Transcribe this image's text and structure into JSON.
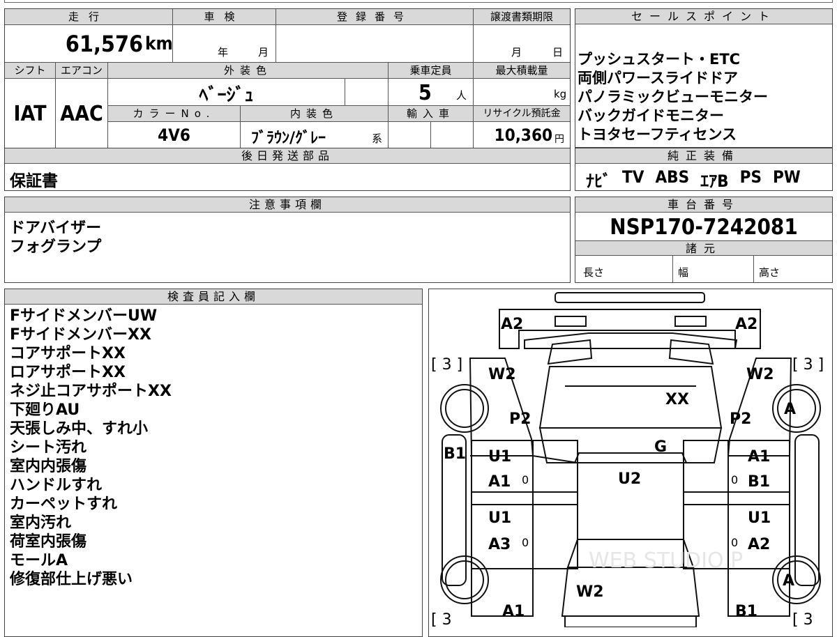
{
  "vehicle": {
    "mileage_label": "走行",
    "mileage": "61,576",
    "mileage_unit": "km",
    "inspection_label": "車検",
    "inspection_year": "年",
    "inspection_month": "月",
    "registration_label": "登録番号",
    "registration_value": "",
    "transfer_label": "譲渡書類期限",
    "transfer_month": "月",
    "transfer_day": "日",
    "shift_label": "シフト",
    "shift": "IAT",
    "aircon_label": "エアコン",
    "aircon": "AAC",
    "exterior_color_label": "外装色",
    "exterior_color": "ﾍﾞｰｼﾞｭ",
    "capacity_label": "乗車定員",
    "capacity": "5",
    "capacity_unit": "人",
    "max_load_label": "最大積載量",
    "max_load_unit": "kg",
    "color_no_label": "カラーNo.",
    "color_no": "4V6",
    "interior_color_label": "内装色",
    "interior_color": "ﾌﾞﾗｳﾝ/ｸﾞﾚｰ",
    "interior_suffix": "系",
    "import_label": "輸入車",
    "recycle_label": "リサイクル預託金",
    "recycle_value": "10,360",
    "recycle_unit": "円"
  },
  "later_shipping": {
    "label": "後日発送部品",
    "value": "保証書"
  },
  "sales_points": {
    "label": "セールスポイント",
    "items": [
      "プッシュスタート・ETC",
      "両側パワースライドドア",
      "パノラミックビューモニター",
      "バックガイドモニター",
      "トヨタセーフティセンス"
    ]
  },
  "equipment": {
    "label": "純正装備",
    "items": [
      "ﾅﾋﾞ",
      "TV",
      "ABS",
      "ｴｱB",
      "PS",
      "PW"
    ]
  },
  "notes": {
    "label": "注意事項欄",
    "items": [
      "ドアバイザー",
      "フォグランプ"
    ]
  },
  "chassis": {
    "label": "車台番号",
    "value": "NSP170-7242081",
    "specs_label": "諸元",
    "length_label": "長さ",
    "width_label": "幅",
    "height_label": "高さ"
  },
  "inspector": {
    "label": "検査員記入欄",
    "items": [
      "FサイドメンバーUW",
      "FサイドメンバーXX",
      "コアサポートXX",
      "ロアサポートXX",
      "ネジ止コアサポートXX",
      "下廻りAU",
      "天張しみ中、すれ小",
      "シート汚れ",
      "室内内張傷",
      "ハンドルすれ",
      "カーペットすれ",
      "室内汚れ",
      "荷室内張傷",
      "モールA",
      "修復部仕上げ悪い"
    ]
  },
  "diagram": {
    "marks": {
      "a2_left": "A2",
      "a2_right": "A2",
      "bracket_tl": "[ 3 ]",
      "bracket_tr": "[ 3 ]",
      "bracket_bl": "[ 3",
      "bracket_br": "[ 3",
      "w2_left": "W2",
      "w2_right": "W2",
      "xx_center": "XX",
      "p2_left": "P2",
      "p2_right": "P2",
      "a_right_top": "A",
      "g_center": "G",
      "b1_left": "B1",
      "u1_left_top": "U1",
      "a1_right_top": "A1",
      "u2_center": "U2",
      "a1_left": "A1",
      "b1_right": "B1",
      "u1_left_bottom": "U1",
      "u1_right_bottom": "U1",
      "a3_left": "A3",
      "a2_right_bottom": "A2",
      "a_right_bottom": "A",
      "w2_rear": "W2",
      "a1_left_bottom": "A1",
      "b1_right_bottom": "B1",
      "zero_1": "0",
      "zero_2": "0",
      "zero_3": "0",
      "zero_4": "0"
    },
    "watermark": "WEB STUDIO P"
  }
}
